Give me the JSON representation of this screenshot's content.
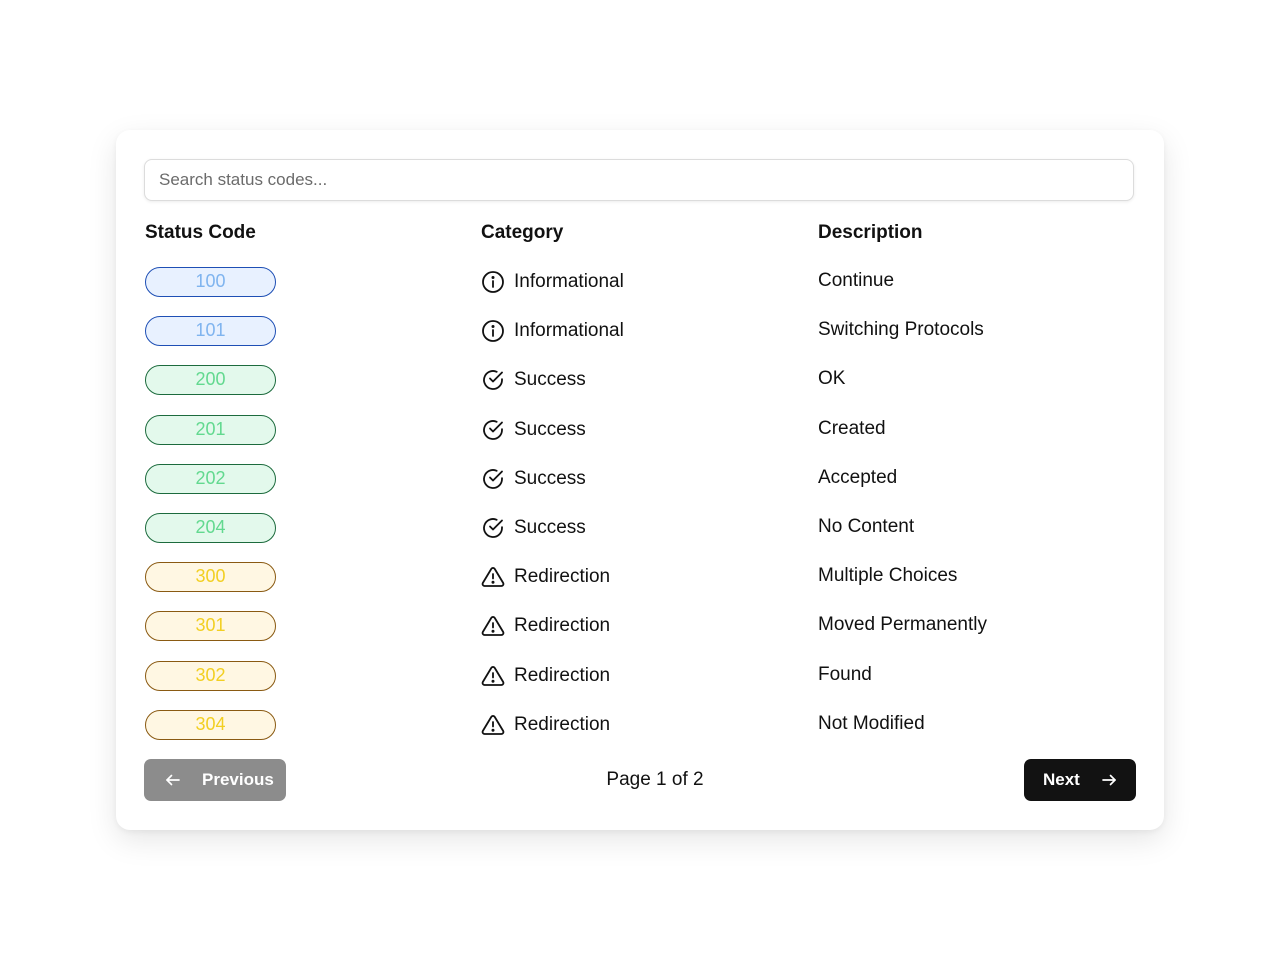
{
  "search": {
    "placeholder": "Search status codes..."
  },
  "table": {
    "headers": {
      "code": "Status Code",
      "category": "Category",
      "description": "Description"
    },
    "rows": [
      {
        "code": "100",
        "category": "Informational",
        "description": "Continue",
        "icon": "info-icon"
      },
      {
        "code": "101",
        "category": "Informational",
        "description": "Switching Protocols",
        "icon": "info-icon"
      },
      {
        "code": "200",
        "category": "Success",
        "description": "OK",
        "icon": "check-circle-icon"
      },
      {
        "code": "201",
        "category": "Success",
        "description": "Created",
        "icon": "check-circle-icon"
      },
      {
        "code": "202",
        "category": "Success",
        "description": "Accepted",
        "icon": "check-circle-icon"
      },
      {
        "code": "204",
        "category": "Success",
        "description": "No Content",
        "icon": "check-circle-icon"
      },
      {
        "code": "300",
        "category": "Redirection",
        "description": "Multiple Choices",
        "icon": "warning-triangle-icon"
      },
      {
        "code": "301",
        "category": "Redirection",
        "description": "Moved Permanently",
        "icon": "warning-triangle-icon"
      },
      {
        "code": "302",
        "category": "Redirection",
        "description": "Found",
        "icon": "warning-triangle-icon"
      },
      {
        "code": "304",
        "category": "Redirection",
        "description": "Not Modified",
        "icon": "warning-triangle-icon"
      }
    ]
  },
  "pagination": {
    "previous_label": "Previous",
    "next_label": "Next",
    "page_text": "Page 1 of 2"
  },
  "colors": {
    "informational": {
      "bg": "#e8f1ff",
      "border": "#1e4fb5",
      "text": "#7fb4ef"
    },
    "success": {
      "bg": "#e3f9ec",
      "border": "#1c6b3d",
      "text": "#62d98f"
    },
    "redirection": {
      "bg": "#fff7e3",
      "border": "#8a5a12",
      "text": "#f2cf22"
    },
    "previous_button": "#8c8c8c",
    "next_button": "#121212"
  }
}
